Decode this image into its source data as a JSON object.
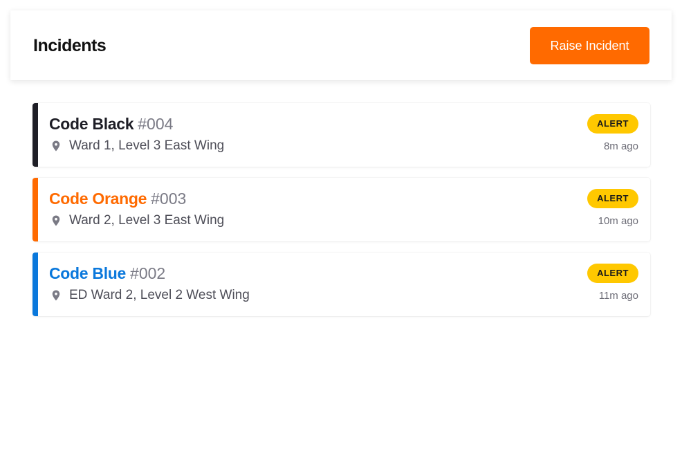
{
  "header": {
    "title": "Incidents",
    "raise_button_label": "Raise Incident"
  },
  "colors": {
    "accent": "#ff6a00",
    "badge_alert": "#ffc800",
    "pin_icon": "#7a7a85"
  },
  "incidents": [
    {
      "code": "Code Black",
      "number": "#004",
      "location": "Ward 1, Level 3 East Wing",
      "status": "ALERT",
      "time": "8m ago",
      "color": "#1e1e26",
      "title_color": "#1e1e26",
      "location_icon": "map-pin-icon"
    },
    {
      "code": "Code Orange",
      "number": "#003",
      "location": "Ward 2, Level 3 East Wing",
      "status": "ALERT",
      "time": "10m ago",
      "color": "#ff6a00",
      "title_color": "#ff6a00",
      "location_icon": "map-pin-icon"
    },
    {
      "code": "Code Blue",
      "number": "#002",
      "location": "ED Ward 2, Level 2 West Wing",
      "status": "ALERT",
      "time": "11m ago",
      "color": "#0a78dc",
      "title_color": "#0a78dc",
      "location_icon": "map-pin-icon"
    }
  ]
}
